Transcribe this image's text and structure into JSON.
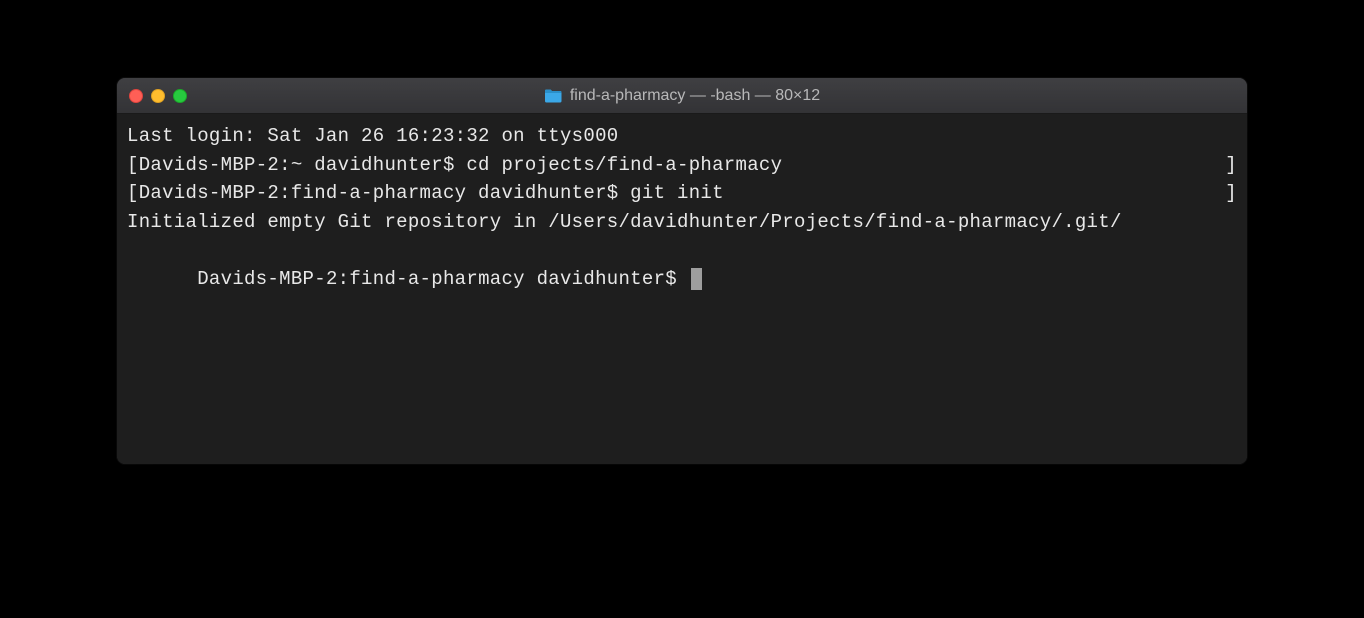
{
  "window": {
    "title": "find-a-pharmacy — -bash — 80×12"
  },
  "terminal": {
    "lines": {
      "0": "Last login: Sat Jan 26 16:23:32 on ttys000",
      "1_left": "[Davids-MBP-2:~ davidhunter$ cd projects/find-a-pharmacy",
      "1_right": "]",
      "2_left": "[Davids-MBP-2:find-a-pharmacy davidhunter$ git init",
      "2_right": "]",
      "3": "Initialized empty Git repository in /Users/davidhunter/Projects/find-a-pharmacy/.git/",
      "4_prompt": "Davids-MBP-2:find-a-pharmacy davidhunter$ "
    }
  }
}
